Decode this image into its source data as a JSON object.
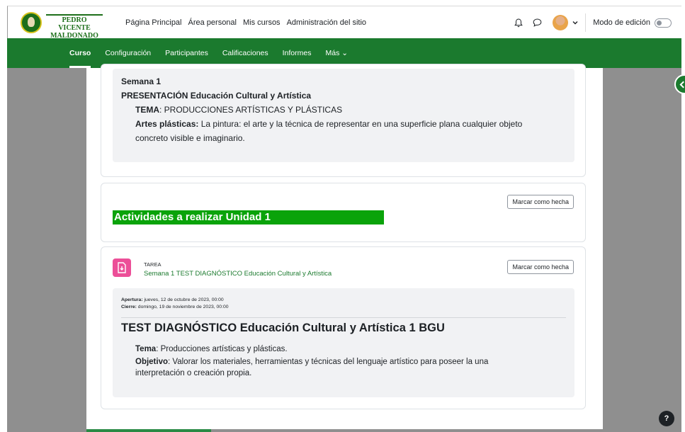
{
  "header": {
    "logo_text": "PEDRO VICENTE MALDONADO",
    "nav": [
      "Página Principal",
      "Área personal",
      "Mis cursos",
      "Administración del sitio"
    ],
    "edit_mode_label": "Modo de edición"
  },
  "course_nav": {
    "items": [
      "Curso",
      "Configuración",
      "Participantes",
      "Calificaciones",
      "Informes",
      "Más ⌄"
    ],
    "active": "Curso"
  },
  "section1": {
    "week": "Semana 1",
    "presentation": "PRESENTACIÓN Educación Cultural y Artística",
    "tema_label": "TEMA",
    "tema_value": ": PRODUCCIONES ARTÍSTICAS Y PLÁSTICAS",
    "artes_label": "Artes plásticas:",
    "artes_value": " La pintura: el arte y la técnica de representar en una superficie plana cualquier objeto",
    "artes_value2": "concreto visible e imaginario."
  },
  "section2": {
    "banner": "Actividades a realizar Unidad 1",
    "mark_done": "Marcar como hecha"
  },
  "task": {
    "type": "TAREA",
    "link": "Semana 1 TEST DIAGNÓSTICO Educación Cultural y Artística",
    "mark_done": "Marcar como hecha",
    "opening_label": "Apertura:",
    "opening_value": " jueves, 12 de octubre de 2023, 00:00",
    "closing_label": "Cierre:",
    "closing_value": " domingo, 19 de noviembre de 2023, 00:00",
    "title": "TEST DIAGNÓSTICO Educación Cultural y Artística 1 BGU",
    "tema_label": "Tema",
    "tema_value": ": Producciones artísticas y plásticas.",
    "objetivo_label": "Objetivo",
    "objetivo_value": ": Valorar los materiales, herramientas y técnicas del lenguaje artístico para poseer la una",
    "objetivo_value2": "interpretación o creación propia."
  },
  "help": {
    "label": "?"
  },
  "colors": {
    "brand_green": "#1b7a2e",
    "banner_green": "#0aa30a",
    "task_pink": "#ec4f98"
  },
  "icons": [
    "bell-icon",
    "chat-icon",
    "avatar",
    "chevron-down-icon",
    "toggle",
    "assignment-icon",
    "drawer-toggle-icon",
    "help-icon"
  ]
}
